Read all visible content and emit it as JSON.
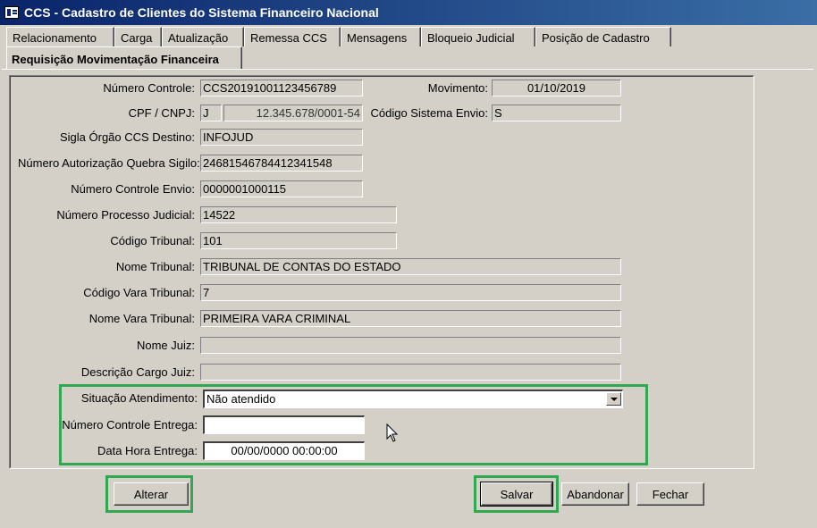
{
  "window": {
    "title": "CCS - Cadastro de Clientes do Sistema Financeiro Nacional"
  },
  "tabs": [
    {
      "label": "Relacionamento"
    },
    {
      "label": "Carga"
    },
    {
      "label": "Atualização"
    },
    {
      "label": "Remessa CCS"
    },
    {
      "label": "Mensagens"
    },
    {
      "label": "Bloqueio Judicial"
    },
    {
      "label": "Posição de Cadastro"
    }
  ],
  "active_tab": {
    "label": "Requisição Movimentação Financeira"
  },
  "form": {
    "numero_controle": {
      "label": "Número Controle:",
      "value": "CCS20191001123456789"
    },
    "movimento": {
      "label": "Movimento:",
      "value": "01/10/2019"
    },
    "cpf_cnpj": {
      "label": "CPF / CNPJ:",
      "type_value": "J",
      "value": "12.345.678/0001-54"
    },
    "codigo_sistema_envio": {
      "label": "Código Sistema Envio:",
      "value": "S"
    },
    "sigla_orgao": {
      "label": "Sigla Órgão CCS Destino:",
      "value": "INFOJUD"
    },
    "numero_autorizacao": {
      "label": "Número Autorização Quebra Sigilo:",
      "value": "24681546784412341548"
    },
    "numero_controle_envio": {
      "label": "Número Controle Envio:",
      "value": "0000001000115"
    },
    "numero_processo": {
      "label": "Número Processo Judicial:",
      "value": "14522"
    },
    "codigo_tribunal": {
      "label": "Código Tribunal:",
      "value": "101"
    },
    "nome_tribunal": {
      "label": "Nome Tribunal:",
      "value": "TRIBUNAL DE CONTAS DO ESTADO"
    },
    "codigo_vara": {
      "label": "Código Vara Tribunal:",
      "value": "7"
    },
    "nome_vara": {
      "label": "Nome Vara Tribunal:",
      "value": "PRIMEIRA VARA CRIMINAL"
    },
    "nome_juiz": {
      "label": "Nome Juiz:",
      "value": ""
    },
    "descricao_cargo": {
      "label": "Descrição Cargo Juiz:",
      "value": ""
    },
    "situacao": {
      "label": "Situação Atendimento:",
      "value": "Não atendido"
    },
    "numero_controle_entrega": {
      "label": "Número Controle Entrega:",
      "value": ""
    },
    "data_hora_entrega": {
      "label": "Data Hora Entrega:",
      "value": "00/00/0000 00:00:00"
    }
  },
  "buttons": {
    "alterar": "Alterar",
    "salvar": "Salvar",
    "abandonar": "Abandonar",
    "fechar": "Fechar"
  },
  "highlight_color": "#2fa84f",
  "icons": [
    "app-icon",
    "chevron-down-icon",
    "mouse-pointer-icon"
  ]
}
